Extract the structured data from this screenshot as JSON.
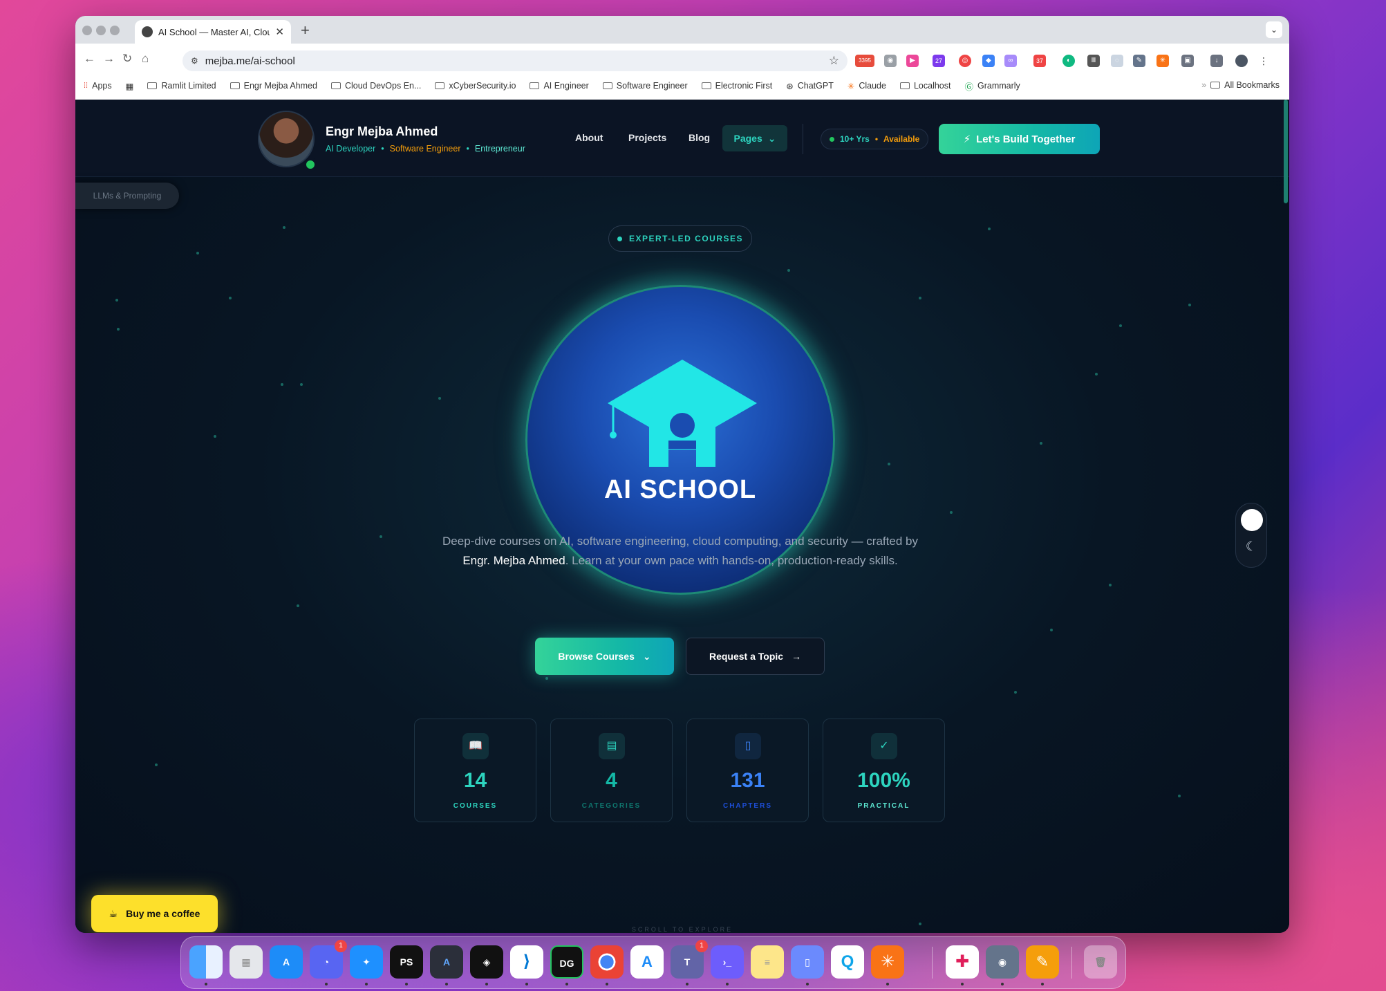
{
  "browser": {
    "tab_title": "AI School — Master AI, Cloud",
    "tab_close": "✕",
    "new_tab": "+",
    "url": "mejba.me/ai-school",
    "bookmarks": [
      "Apps",
      "Ramlit Limited",
      "Engr Mejba Ahmed",
      "Cloud DevOps En...",
      "xCyberSecurity.io",
      "AI Engineer",
      "Software Engineer",
      "Electronic First",
      "ChatGPT",
      "Claude",
      "Localhost",
      "Grammarly"
    ],
    "all_bookmarks": "All Bookmarks",
    "ext_badges": {
      "mail": "3395",
      "ext1": "27",
      "ext2": "37"
    }
  },
  "header": {
    "name": "Engr Mejba Ahmed",
    "role1": "AI Developer",
    "role2": "Software Engineer",
    "role3": "Entrepreneur",
    "nav_about": "About",
    "nav_projects": "Projects",
    "nav_blog": "Blog",
    "nav_pages": "Pages",
    "years": "10+ Yrs",
    "available": "Available",
    "cta": "Let's Build Together"
  },
  "side_tag": "LLMs & Prompting",
  "hero": {
    "pill": "EXPERT-LED COURSES",
    "logo_text": "AI SCHOOL",
    "desc_before": "Deep-dive courses on AI, software engineering, cloud computing, and security — crafted by ",
    "desc_name": "Engr. Mejba Ahmed",
    "desc_after": ". Learn at your own pace with hands-on, production-ready skills.",
    "browse": "Browse Courses",
    "request": "Request a Topic"
  },
  "stats": [
    {
      "value": "14",
      "label": "COURSES",
      "color": "#2dd4bf"
    },
    {
      "value": "4",
      "label": "CATEGORIES",
      "color": "#14b8a6"
    },
    {
      "value": "131",
      "label": "CHAPTERS",
      "color": "#3b82f6"
    },
    {
      "value": "100%",
      "label": "PRACTICAL",
      "color": "#2dd4bf"
    }
  ],
  "scroll_hint": "SCROLL TO EXPLORE",
  "coffee": "Buy me a coffee",
  "dock": {
    "discord_badge": "1",
    "teams_badge": "1",
    "phpstorm": "PS",
    "datagrip": "DG"
  },
  "colors": {
    "accent": "#2dd4bf",
    "accent_gold": "#f59e0b",
    "bg": "#081624"
  }
}
